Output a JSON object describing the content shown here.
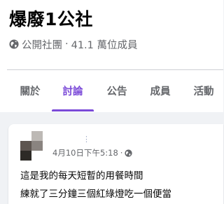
{
  "group": {
    "name": "爆廢1公社",
    "privacy": "公開社團",
    "separator": "·",
    "members": "41.1 萬位成員",
    "privacy_icon": "globe-icon"
  },
  "tabs": [
    {
      "label": "關於",
      "active": false
    },
    {
      "label": "討論",
      "active": true
    },
    {
      "label": "公告",
      "active": false
    },
    {
      "label": "成員",
      "active": false
    },
    {
      "label": "活動",
      "active": false
    }
  ],
  "accent_color": "#7b4ad8",
  "post": {
    "timestamp": "4月10日下午5:18",
    "separator": "·",
    "audience_icon": "globe-icon",
    "lines": [
      "這是我的每天短暫的用餐時間",
      "練就了三分鐘三個紅綠燈吃一個便當"
    ]
  }
}
